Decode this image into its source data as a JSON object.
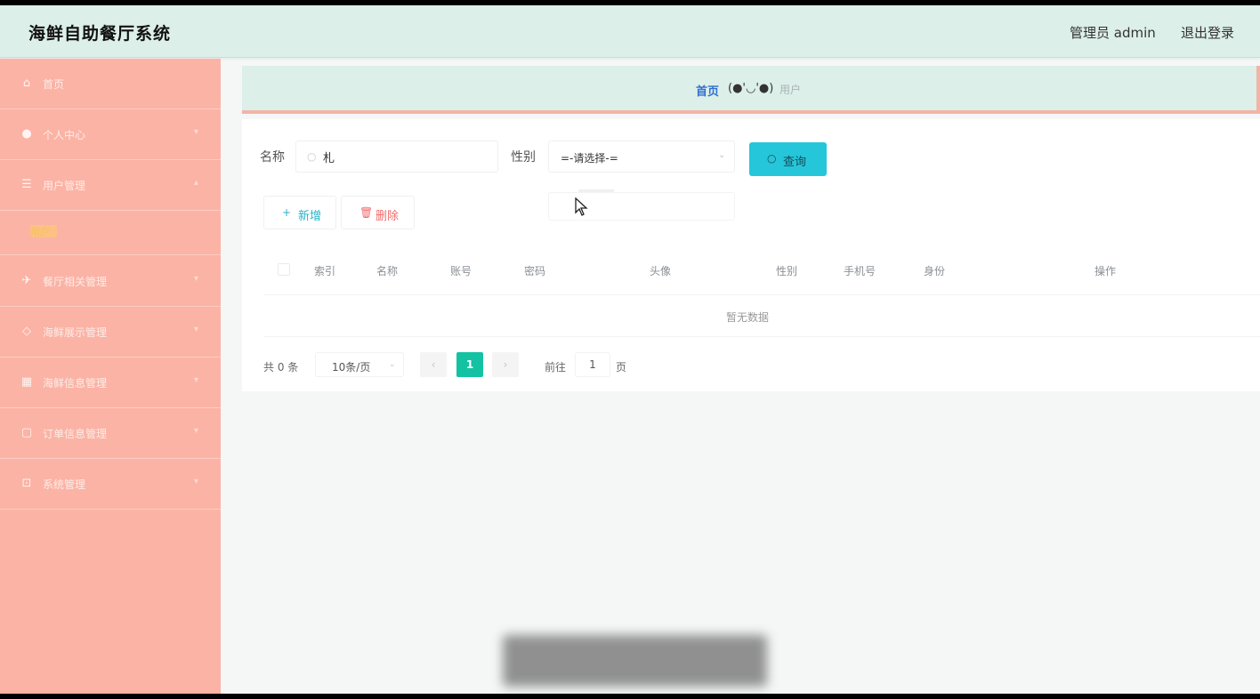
{
  "header": {
    "app_title": "海鲜自助餐厅系统",
    "admin_label": "管理员 admin",
    "logout_label": "退出登录"
  },
  "sidebar": {
    "items": [
      {
        "label": "首页",
        "icon": "home-icon"
      },
      {
        "label": "个人中心",
        "icon": "user-icon"
      },
      {
        "label": "用户管理",
        "icon": "list-icon"
      },
      {
        "label": "餐厅相关管理",
        "icon": "bird-icon"
      },
      {
        "label": "海鲜展示管理",
        "icon": "tag-icon"
      },
      {
        "label": "海鲜信息管理",
        "icon": "grid-icon"
      },
      {
        "label": "订单信息管理",
        "icon": "doc-icon"
      },
      {
        "label": "系统管理",
        "icon": "window-icon"
      }
    ],
    "sub_item_label": "用户"
  },
  "breadcrumb": {
    "home": "首页",
    "face": "(●'◡'●)",
    "current": "用户"
  },
  "search": {
    "name_label": "名称",
    "name_value": "札",
    "gender_label": "性别",
    "gender_value": "=-请选择-=",
    "query_label": "查询"
  },
  "toolbar": {
    "add_label": "新增",
    "delete_label": "删除"
  },
  "table": {
    "columns": [
      "索引",
      "名称",
      "账号",
      "密码",
      "头像",
      "性别",
      "手机号",
      "身份",
      "操作"
    ],
    "empty_text": "暂无数据"
  },
  "pagination": {
    "total_text": "共 0 条",
    "page_size": "10条/页",
    "current_page": "1",
    "prev": "‹",
    "next": "›",
    "goto_label": "前往",
    "goto_value": "1",
    "goto_unit": "页"
  },
  "colors": {
    "sidebar_bg": "#fbb3a5",
    "header_bg": "#dcefe8",
    "query_button": "#26c6da",
    "active_page": "#13c2a2"
  }
}
